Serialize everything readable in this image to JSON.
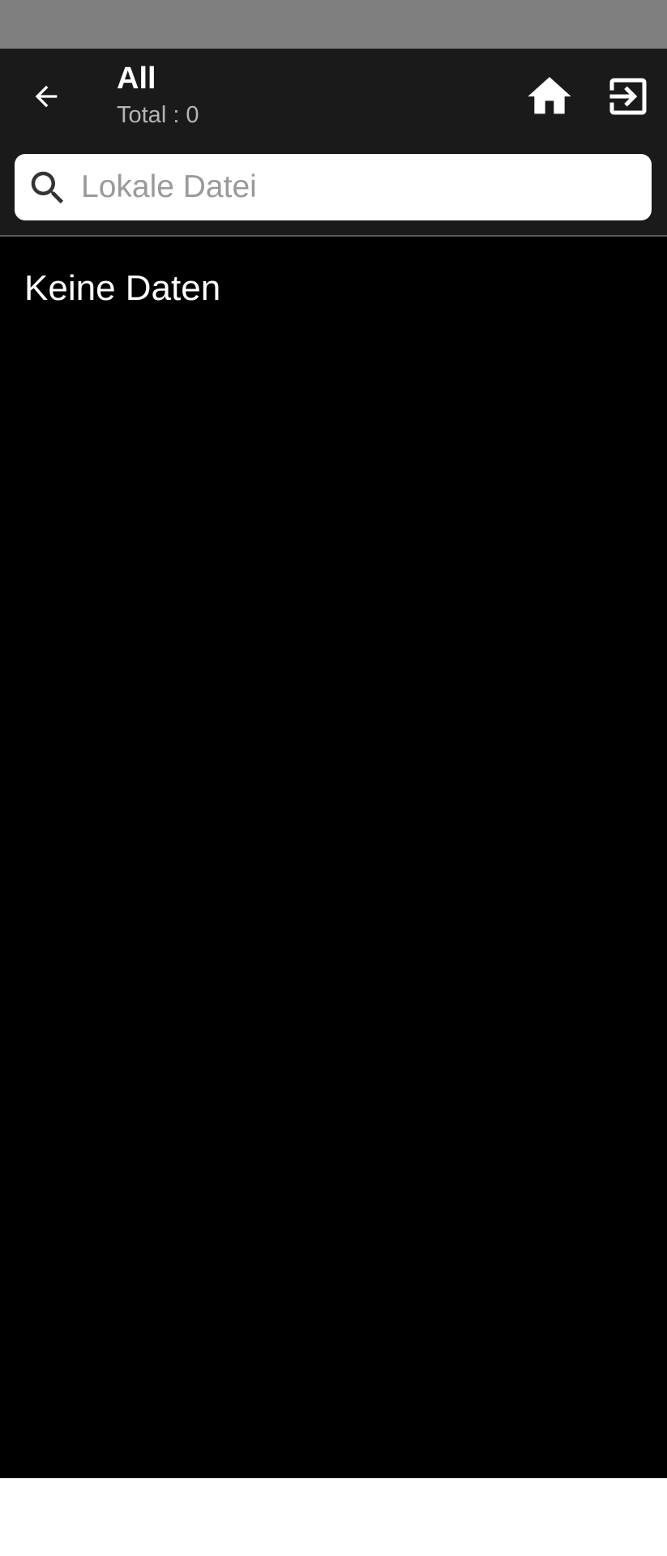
{
  "header": {
    "title": "All",
    "subtitle": "Total : 0",
    "back_icon": "arrow-left-icon",
    "home_icon": "home-icon",
    "exit_icon": "exit-icon"
  },
  "search": {
    "placeholder": "Lokale Datei",
    "value": "",
    "icon": "search-icon"
  },
  "content": {
    "empty_message": "Keine Daten"
  },
  "colors": {
    "status_bar": "#7f7f7f",
    "app_bar": "#1a1a1a",
    "background": "#000000",
    "text_primary": "#ffffff",
    "text_secondary": "#b4b4b4",
    "search_bg": "#ffffff",
    "placeholder": "#9a9a9a"
  }
}
